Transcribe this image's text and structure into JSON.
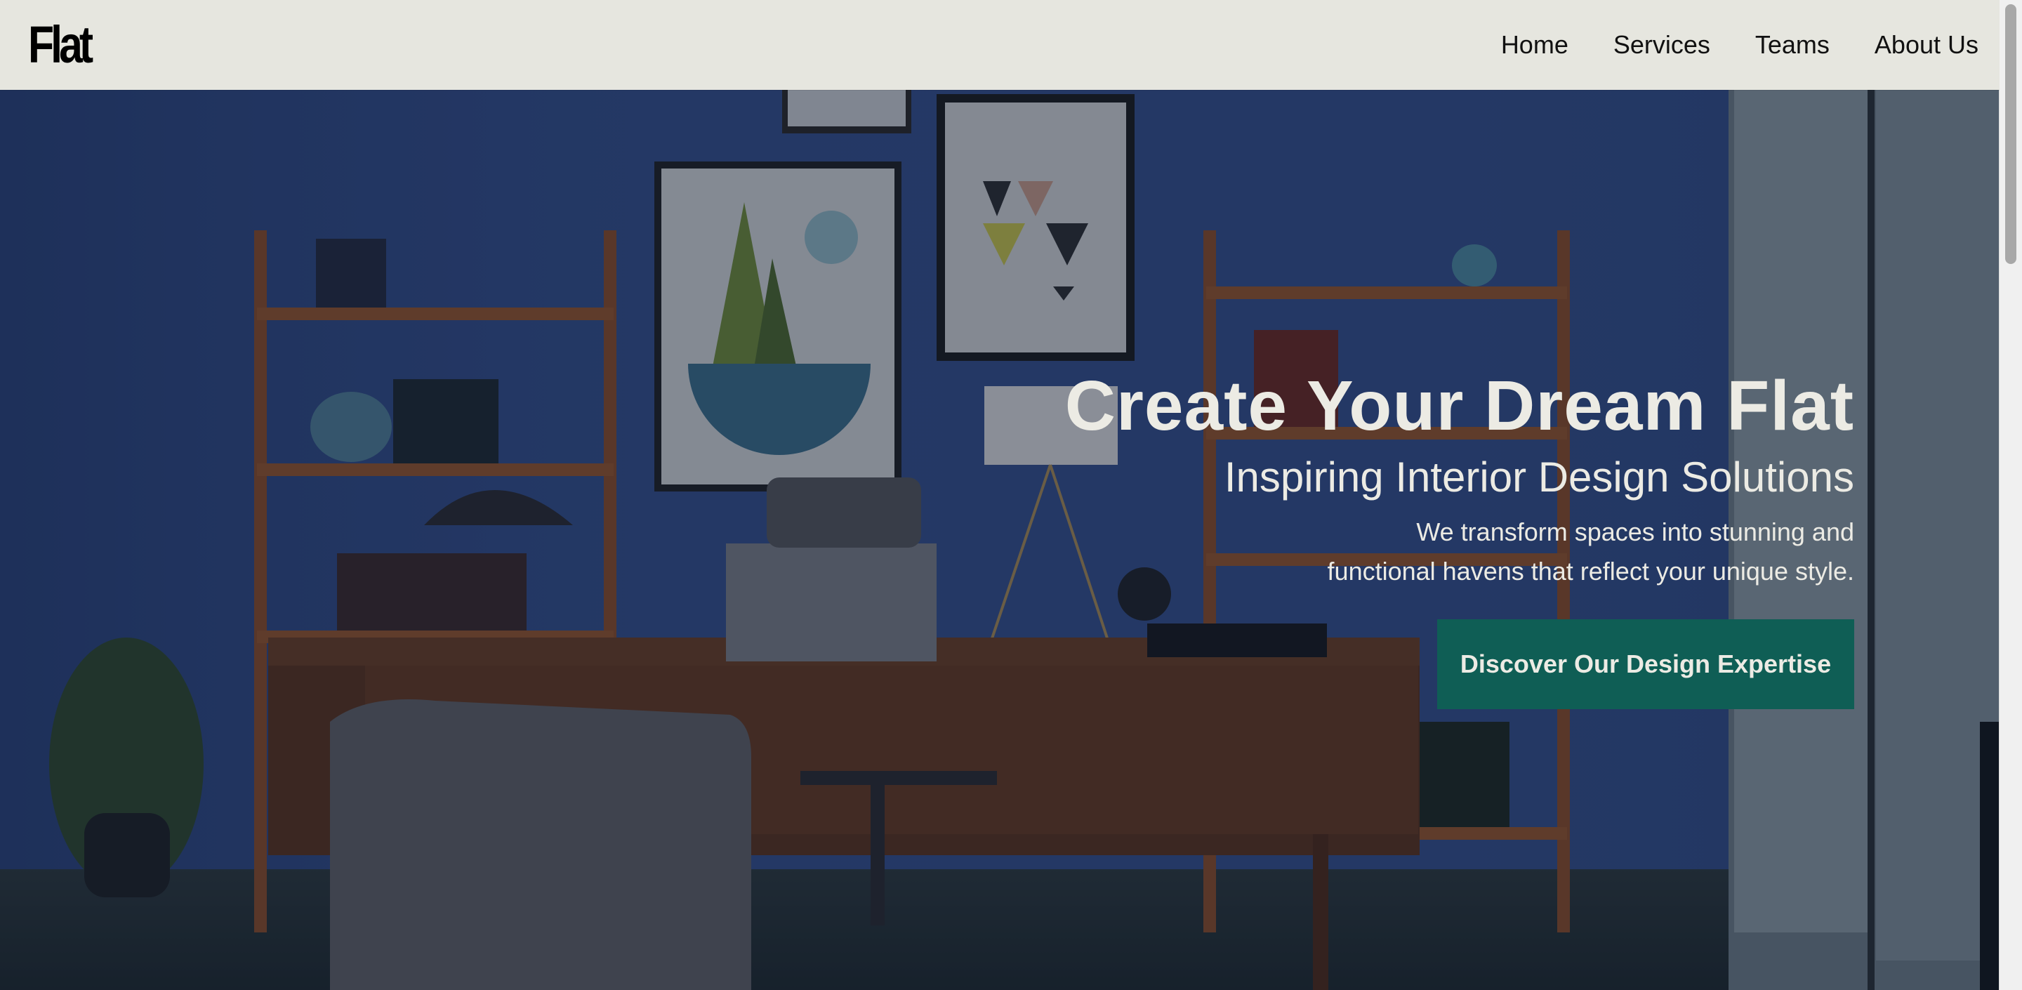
{
  "brand": {
    "logo": "Flat"
  },
  "nav": {
    "items": [
      {
        "label": "Home"
      },
      {
        "label": "Services"
      },
      {
        "label": "Teams"
      },
      {
        "label": "About Us"
      }
    ]
  },
  "hero": {
    "title": "Create Your Dream Flat",
    "subtitle": "Inspiring Interior Design Solutions",
    "description_line1": "We transform spaces into stunning and",
    "description_line2": "functional havens that reflect your unique style.",
    "cta_label": "Discover Our Design Expertise",
    "background_image": "home-office-interior-photo"
  },
  "colors": {
    "navbar_bg": "#e6e6df",
    "cta_bg": "#0f5e55",
    "hero_text": "#ecebe4",
    "wall": "#2e4378"
  },
  "icons": {
    "scrollbar": "vertical-scrollbar"
  }
}
